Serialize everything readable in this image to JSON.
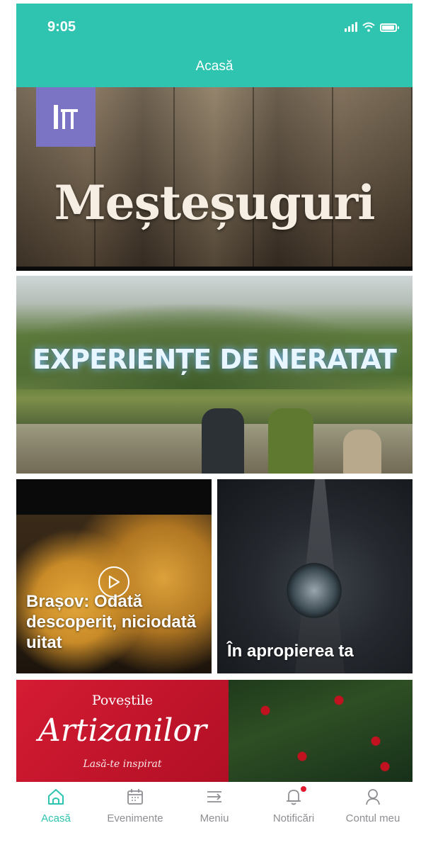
{
  "status_bar": {
    "time": "9:05"
  },
  "header": {
    "title": "Acasă"
  },
  "cards": {
    "crafts": {
      "title": "Meșteșuguri"
    },
    "experience": {
      "title": "EXPERIENȚE DE NERATAT"
    },
    "food": {
      "caption": "Brașov: Odată descoperit, niciodată uitat"
    },
    "nearby": {
      "caption": "În apropierea ta"
    },
    "artisans": {
      "top": "Poveștile",
      "main": "Artizanilor",
      "sub": "Lasă-te inspirat"
    }
  },
  "tabbar": {
    "accent": "#2ec4b0",
    "items": [
      {
        "label": "Acasă",
        "icon": "home-icon",
        "active": true
      },
      {
        "label": "Evenimente",
        "icon": "calendar-icon"
      },
      {
        "label": "Meniu",
        "icon": "menu-icon"
      },
      {
        "label": "Notificări",
        "icon": "bell-icon",
        "badge": true
      },
      {
        "label": "Contul meu",
        "icon": "user-icon"
      }
    ]
  }
}
